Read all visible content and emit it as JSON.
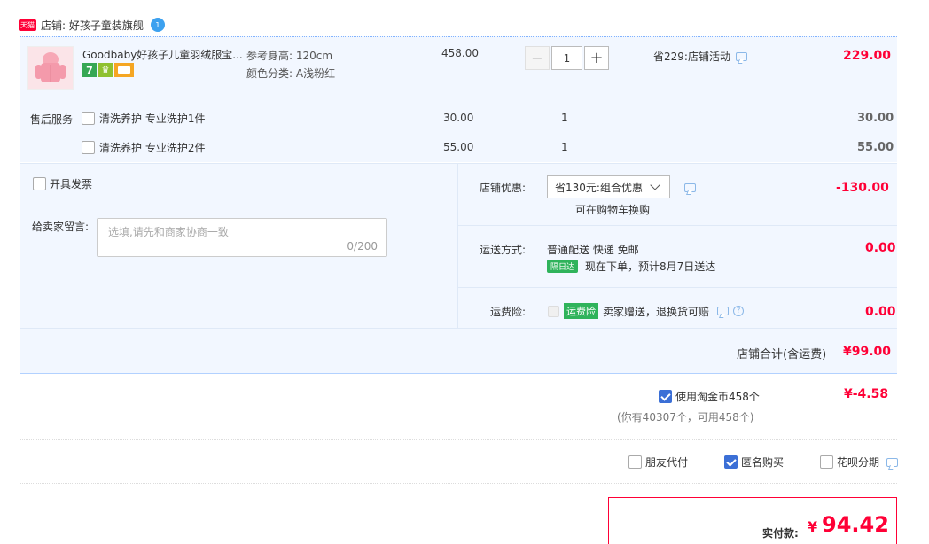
{
  "shop": {
    "badge": "天猫",
    "label": "店铺: 好孩子童装旗舰",
    "chat_badge": "1"
  },
  "product": {
    "title": "Goodbaby好孩子儿童羽绒服宝...",
    "height_label": "参考身高: 120cm",
    "color_label": "颜色分类: A浅粉红",
    "unit_price": "458.00",
    "quantity": "1",
    "promo": "省229:店铺活动",
    "subtotal": "229.00",
    "tag_icons": [
      "7-day-return-icon",
      "guarantee-icon",
      "card-icon"
    ]
  },
  "after_sales": {
    "label": "售后服务",
    "items": [
      {
        "name": "清洗养护 专业洗护1件",
        "price": "30.00",
        "qty": "1",
        "total": "30.00"
      },
      {
        "name": "清洗养护 专业洗护2件",
        "price": "55.00",
        "qty": "1",
        "total": "55.00"
      }
    ]
  },
  "invoice": {
    "label": "开具发票"
  },
  "message": {
    "label": "给卖家留言:",
    "placeholder": "选填,请先和商家协商一致",
    "counter": "0/200"
  },
  "discount": {
    "label": "店铺优惠:",
    "selected": "省130元:组合优惠",
    "hint": "可在购物车换购",
    "amount": "-130.00"
  },
  "shipping": {
    "label": "运送方式:",
    "method": "普通配送 快递 免邮",
    "badge": "隔日达",
    "eta": "现在下单，预计8月7日送达",
    "amount": "0.00"
  },
  "insurance": {
    "label": "运费险:",
    "badge": "运费险",
    "text": "卖家赠送，退换货可赔",
    "amount": "0.00"
  },
  "shop_total": {
    "label": "店铺合计(含运费)",
    "amount": "¥99.00"
  },
  "coins": {
    "label": "使用淘金币458个",
    "sub": "(你有40307个，可用458个)",
    "amount": "¥-4.58"
  },
  "options": {
    "friend_pay": "朋友代付",
    "anonymous": "匿名购买",
    "huabei": "花呗分期"
  },
  "final": {
    "label": "实付款:",
    "amount": "94.42",
    "currency": "¥"
  },
  "colors": {
    "accent": "#ff0036",
    "panel_bg": "#f2f7ff",
    "border": "#b2d1ff",
    "brand_blue": "#3b6fd6"
  }
}
